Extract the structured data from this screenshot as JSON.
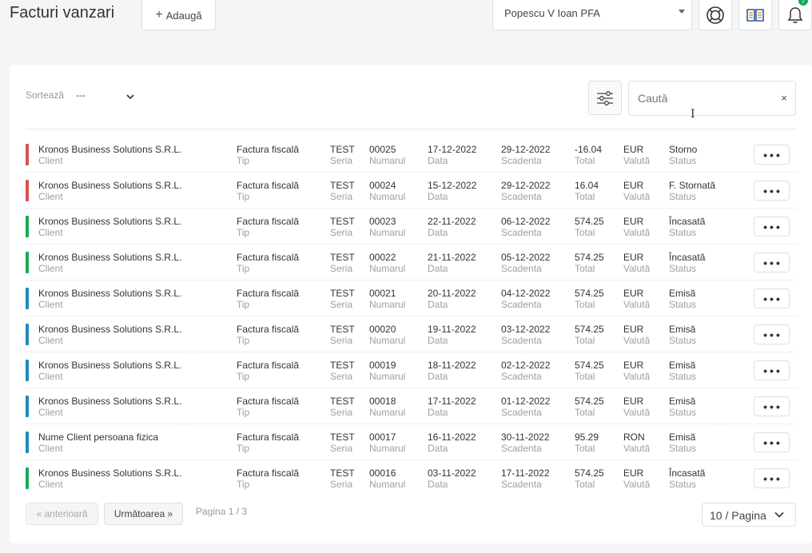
{
  "header": {
    "title": "Facturi vanzari",
    "add_label": "Adaugă",
    "company": "Popescu V Ioan PFA",
    "notification_count": "7"
  },
  "toolbar": {
    "sort_label": "Sortează",
    "sort_value": "---",
    "search_placeholder": "Caută",
    "clear_label": "×"
  },
  "labels": {
    "client": "Client",
    "tip": "Tip",
    "seria": "Seria",
    "numar": "Numarul",
    "data": "Data",
    "scadenta": "Scadenta",
    "total": "Total",
    "valuta": "Valută",
    "status": "Status"
  },
  "status_colors": {
    "Storno": "#d9534f",
    "F. Stornată": "#d9534f",
    "Încasată": "#1aaa55",
    "Emisă": "#1f8ac0"
  },
  "invoices": [
    {
      "client": "Kronos Business Solutions S.R.L.",
      "tip": "Factura fiscală",
      "seria": "TEST",
      "numar": "00025",
      "data": "17-12-2022",
      "scadenta": "29-12-2022",
      "total": "-16.04",
      "valuta": "EUR",
      "status": "Storno"
    },
    {
      "client": "Kronos Business Solutions S.R.L.",
      "tip": "Factura fiscală",
      "seria": "TEST",
      "numar": "00024",
      "data": "15-12-2022",
      "scadenta": "29-12-2022",
      "total": "16.04",
      "valuta": "EUR",
      "status": "F. Stornată"
    },
    {
      "client": "Kronos Business Solutions S.R.L.",
      "tip": "Factura fiscală",
      "seria": "TEST",
      "numar": "00023",
      "data": "22-11-2022",
      "scadenta": "06-12-2022",
      "total": "574.25",
      "valuta": "EUR",
      "status": "Încasată"
    },
    {
      "client": "Kronos Business Solutions S.R.L.",
      "tip": "Factura fiscală",
      "seria": "TEST",
      "numar": "00022",
      "data": "21-11-2022",
      "scadenta": "05-12-2022",
      "total": "574.25",
      "valuta": "EUR",
      "status": "Încasată"
    },
    {
      "client": "Kronos Business Solutions S.R.L.",
      "tip": "Factura fiscală",
      "seria": "TEST",
      "numar": "00021",
      "data": "20-11-2022",
      "scadenta": "04-12-2022",
      "total": "574.25",
      "valuta": "EUR",
      "status": "Emisă"
    },
    {
      "client": "Kronos Business Solutions S.R.L.",
      "tip": "Factura fiscală",
      "seria": "TEST",
      "numar": "00020",
      "data": "19-11-2022",
      "scadenta": "03-12-2022",
      "total": "574.25",
      "valuta": "EUR",
      "status": "Emisă"
    },
    {
      "client": "Kronos Business Solutions S.R.L.",
      "tip": "Factura fiscală",
      "seria": "TEST",
      "numar": "00019",
      "data": "18-11-2022",
      "scadenta": "02-12-2022",
      "total": "574.25",
      "valuta": "EUR",
      "status": "Emisă"
    },
    {
      "client": "Kronos Business Solutions S.R.L.",
      "tip": "Factura fiscală",
      "seria": "TEST",
      "numar": "00018",
      "data": "17-11-2022",
      "scadenta": "01-12-2022",
      "total": "574.25",
      "valuta": "EUR",
      "status": "Emisă"
    },
    {
      "client": "Nume Client persoana fizica",
      "tip": "Factura fiscală",
      "seria": "TEST",
      "numar": "00017",
      "data": "16-11-2022",
      "scadenta": "30-11-2022",
      "total": "95.29",
      "valuta": "RON",
      "status": "Emisă"
    },
    {
      "client": "Kronos Business Solutions S.R.L.",
      "tip": "Factura fiscală",
      "seria": "TEST",
      "numar": "00016",
      "data": "03-11-2022",
      "scadenta": "17-11-2022",
      "total": "574.25",
      "valuta": "EUR",
      "status": "Încasată"
    }
  ],
  "pagination": {
    "prev_label": "« anterioară",
    "next_label": "Următoarea »",
    "page_info": "Pagina 1 / 3",
    "per_page": "10 / Pagina"
  }
}
